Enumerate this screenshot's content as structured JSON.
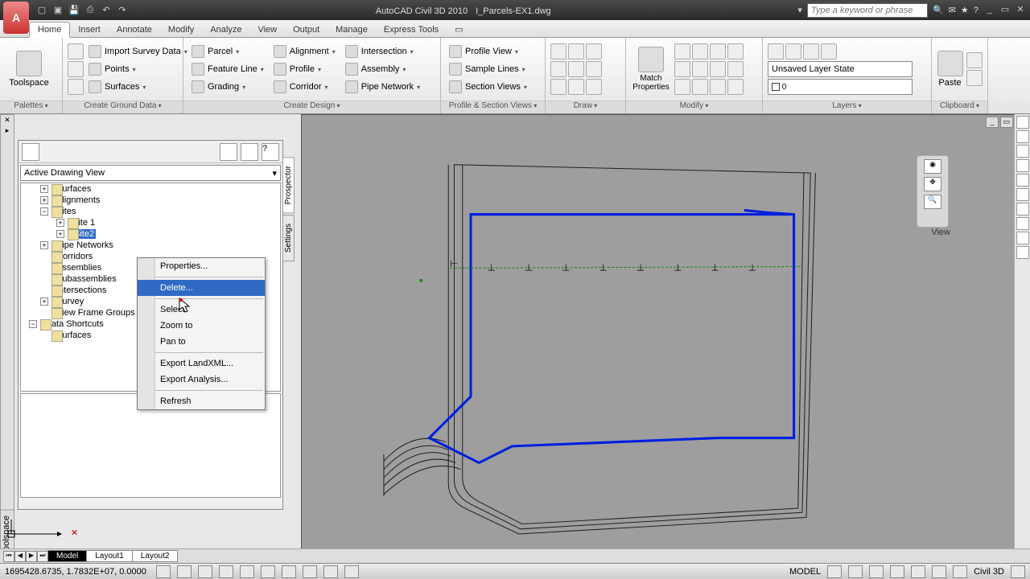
{
  "title_app": "AutoCAD Civil 3D 2010",
  "title_file": "I_Parcels-EX1.dwg",
  "search_placeholder": "Type a keyword or phrase",
  "tabs": [
    "Home",
    "Insert",
    "Annotate",
    "Modify",
    "Analyze",
    "View",
    "Output",
    "Manage",
    "Express Tools"
  ],
  "panels": {
    "palettes": "Palettes",
    "create_ground": "Create Ground Data",
    "create_design": "Create Design",
    "profile_section": "Profile & Section Views",
    "draw": "Draw",
    "modify": "Modify",
    "layers": "Layers",
    "clipboard": "Clipboard"
  },
  "ribbon": {
    "toolspace": "Toolspace",
    "import_survey": "Import Survey Data",
    "points": "Points",
    "surfaces": "Surfaces",
    "parcel": "Parcel",
    "feature_line": "Feature Line",
    "grading": "Grading",
    "alignment": "Alignment",
    "profile": "Profile",
    "corridor": "Corridor",
    "intersection": "Intersection",
    "assembly": "Assembly",
    "pipe_network": "Pipe Network",
    "profile_view": "Profile View",
    "sample_lines": "Sample Lines",
    "section_views": "Section Views",
    "match_props": "Match\nProperties",
    "paste": "Paste",
    "layer_state": "Unsaved Layer State"
  },
  "toolspace": {
    "title": "Toolspace",
    "view_combo": "Active Drawing View",
    "tabs": [
      "Prospector",
      "Settings"
    ],
    "tree": {
      "surfaces": "Surfaces",
      "alignments": "Alignments",
      "sites": "Sites",
      "site1": "Site 1",
      "site2": "Site2",
      "pipe_networks": "Pipe Networks",
      "corridors": "Corridors",
      "assemblies": "Assemblies",
      "subassemblies": "Subassemblies",
      "intersections": "Intersections",
      "survey": "Survey",
      "view_frame": "View Frame Groups",
      "data_shortcuts": "Data Shortcuts",
      "surfaces2": "Surfaces"
    }
  },
  "context_menu": {
    "properties": "Properties...",
    "delete": "Delete...",
    "select": "Select",
    "zoom_to": "Zoom to",
    "pan_to": "Pan to",
    "export_landxml": "Export LandXML...",
    "export_analysis": "Export Analysis...",
    "refresh": "Refresh"
  },
  "nav": {
    "view_label": "View"
  },
  "bottom_tabs": [
    "Model",
    "Layout1",
    "Layout2"
  ],
  "status": {
    "coords": "1695428.6735, 1.7832E+07, 0.0000",
    "model": "MODEL",
    "brand": "Civil 3D"
  }
}
